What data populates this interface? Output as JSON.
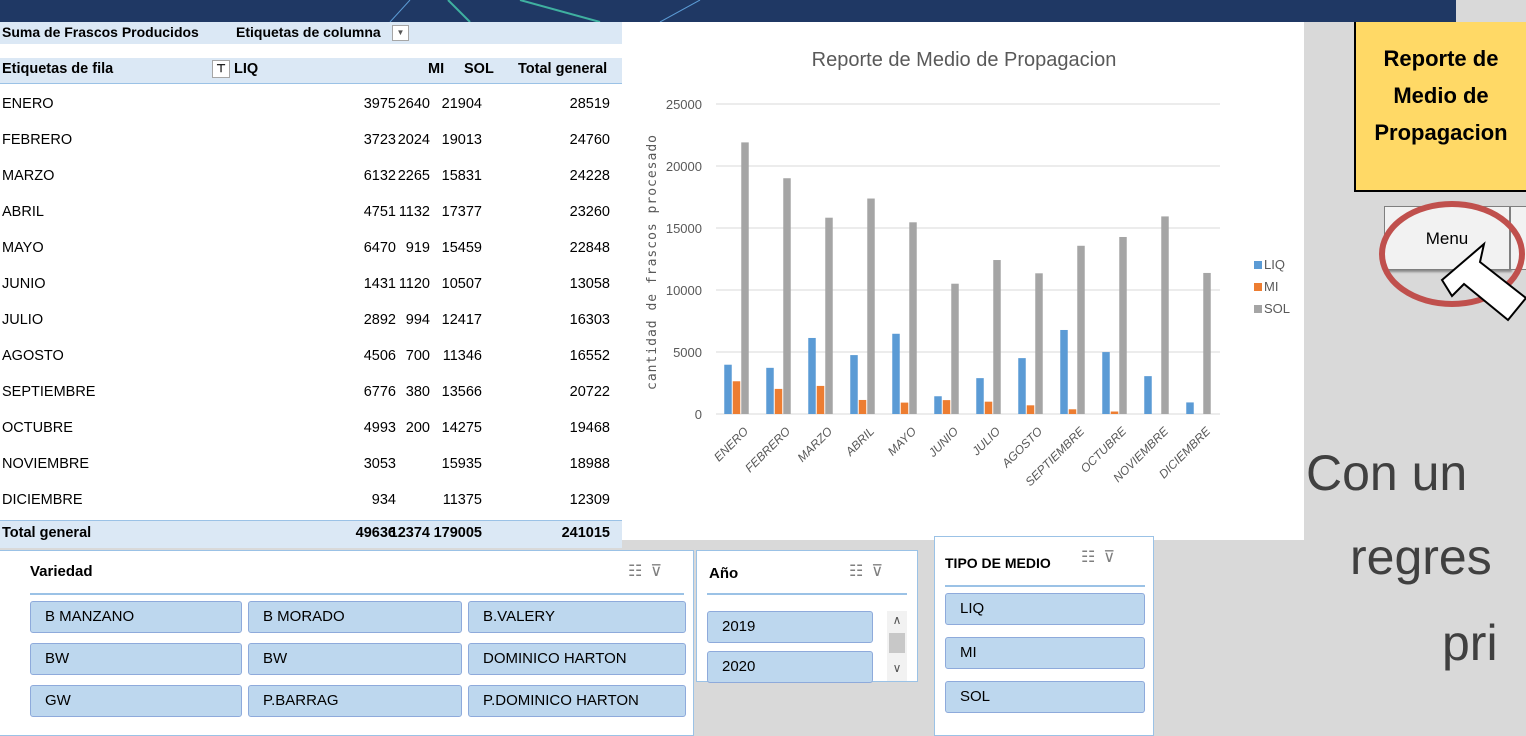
{
  "pivot": {
    "title_value": "Suma de Frascos Producidos",
    "title_columns": "Etiquetas de columna",
    "row_label": "Etiquetas de fila",
    "col_headers": [
      "LIQ",
      "MI",
      "SOL",
      "Total general"
    ],
    "rows": [
      {
        "label": "ENERO",
        "liq": "3975",
        "mi": "2640",
        "sol": "21904",
        "total": "28519"
      },
      {
        "label": "FEBRERO",
        "liq": "3723",
        "mi": "2024",
        "sol": "19013",
        "total": "24760"
      },
      {
        "label": "MARZO",
        "liq": "6132",
        "mi": "2265",
        "sol": "15831",
        "total": "24228"
      },
      {
        "label": "ABRIL",
        "liq": "4751",
        "mi": "1132",
        "sol": "17377",
        "total": "23260"
      },
      {
        "label": "MAYO",
        "liq": "6470",
        "mi": "919",
        "sol": "15459",
        "total": "22848"
      },
      {
        "label": "JUNIO",
        "liq": "1431",
        "mi": "1120",
        "sol": "10507",
        "total": "13058"
      },
      {
        "label": "JULIO",
        "liq": "2892",
        "mi": "994",
        "sol": "12417",
        "total": "16303"
      },
      {
        "label": "AGOSTO",
        "liq": "4506",
        "mi": "700",
        "sol": "11346",
        "total": "16552"
      },
      {
        "label": "SEPTIEMBRE",
        "liq": "6776",
        "mi": "380",
        "sol": "13566",
        "total": "20722"
      },
      {
        "label": "OCTUBRE",
        "liq": "4993",
        "mi": "200",
        "sol": "14275",
        "total": "19468"
      },
      {
        "label": "NOVIEMBRE",
        "liq": "3053",
        "mi": "",
        "sol": "15935",
        "total": "18988"
      },
      {
        "label": "DICIEMBRE",
        "liq": "934",
        "mi": "",
        "sol": "11375",
        "total": "12309"
      }
    ],
    "total": {
      "label": "Total general",
      "liq": "49636",
      "mi": "12374",
      "sol": "179005",
      "total": "241015"
    }
  },
  "chart_data": {
    "type": "bar",
    "title": "Reporte de Medio de Propagacion",
    "ylabel": "cantidad de frascos procesado",
    "xlabel": "",
    "ylim": [
      0,
      25000
    ],
    "yticks": [
      "0",
      "5000",
      "10000",
      "15000",
      "20000",
      "25000"
    ],
    "categories": [
      "ENERO",
      "FEBRERO",
      "MARZO",
      "ABRIL",
      "MAYO",
      "JUNIO",
      "JULIO",
      "AGOSTO",
      "SEPTIEMBRE",
      "OCTUBRE",
      "NOVIEMBRE",
      "DICIEMBRE"
    ],
    "series": [
      {
        "name": "LIQ",
        "color": "#5b9bd5",
        "values": [
          3975,
          3723,
          6132,
          4751,
          6470,
          1431,
          2892,
          4506,
          6776,
          4993,
          3053,
          934
        ]
      },
      {
        "name": "MI",
        "color": "#ed7d31",
        "values": [
          2640,
          2024,
          2265,
          1132,
          919,
          1120,
          994,
          700,
          380,
          200,
          0,
          0
        ]
      },
      {
        "name": "SOL",
        "color": "#a5a5a5",
        "values": [
          21904,
          19013,
          15831,
          17377,
          15459,
          10507,
          12417,
          11346,
          13566,
          14275,
          15935,
          11375
        ]
      }
    ],
    "legend_position": "right",
    "grid": true
  },
  "report_box": {
    "line1": "Reporte de",
    "line2": "Medio de",
    "line3": "Propagacion",
    "color": "#ffd966"
  },
  "menu_button": {
    "label": "Menu"
  },
  "big_text": {
    "line1": "Con un",
    "line2": "regres",
    "line3": "pri"
  },
  "slicer_variedad": {
    "title": "Variedad",
    "items": [
      "B MANZANO",
      "B MORADO",
      "B.VALERY",
      "BW",
      "BW",
      "DOMINICO HARTON",
      "GW",
      "P.BARRAG",
      "P.DOMINICO HARTON"
    ]
  },
  "slicer_anio": {
    "title": "Año",
    "items": [
      "2019",
      "2020"
    ]
  },
  "slicer_tipo": {
    "title": "TIPO DE MEDIO",
    "items": [
      "LIQ",
      "MI",
      "SOL"
    ]
  },
  "icons": {
    "multiselect": "multi-select-icon",
    "clear_filter": "clear-filter-icon",
    "filter": "filter-icon",
    "dropdown": "dropdown-arrow-icon",
    "cursor": "mouse-pointer-icon"
  }
}
